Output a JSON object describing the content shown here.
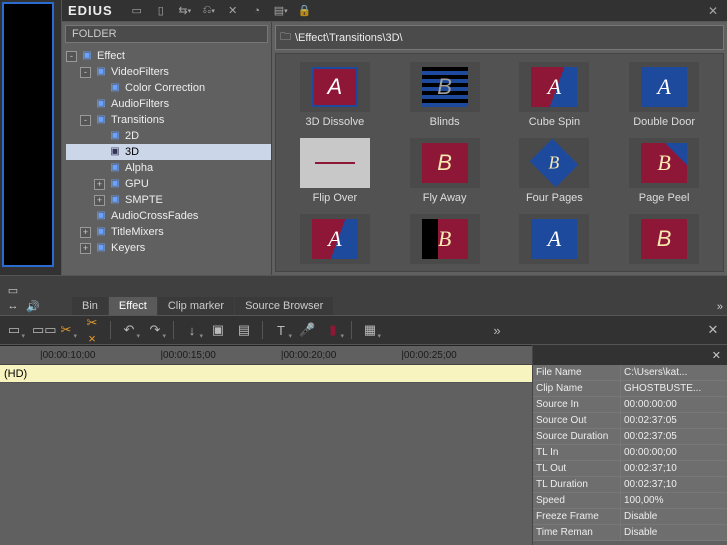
{
  "app": {
    "title": "EDIUS"
  },
  "folder": {
    "header": "FOLDER",
    "tree": [
      {
        "ind": 1,
        "exp": "-",
        "icon": "▣",
        "label": "Effect"
      },
      {
        "ind": 2,
        "exp": "-",
        "icon": "▣",
        "label": "VideoFilters"
      },
      {
        "ind": 3,
        "exp": " ",
        "icon": "▣",
        "label": "Color Correction"
      },
      {
        "ind": 2,
        "exp": " ",
        "icon": "▣",
        "label": "AudioFilters"
      },
      {
        "ind": 2,
        "exp": "-",
        "icon": "▣",
        "label": "Transitions"
      },
      {
        "ind": 3,
        "exp": " ",
        "icon": "▣",
        "label": "2D"
      },
      {
        "ind": 3,
        "exp": " ",
        "icon": "▣",
        "label": "3D",
        "sel": true
      },
      {
        "ind": 3,
        "exp": " ",
        "icon": "▣",
        "label": "Alpha"
      },
      {
        "ind": 3,
        "exp": "+",
        "icon": "▣",
        "label": "GPU"
      },
      {
        "ind": 3,
        "exp": "+",
        "icon": "▣",
        "label": "SMPTE"
      },
      {
        "ind": 2,
        "exp": " ",
        "icon": "▣",
        "label": "AudioCrossFades"
      },
      {
        "ind": 2,
        "exp": "+",
        "icon": "▣",
        "label": "TitleMixers"
      },
      {
        "ind": 2,
        "exp": "+",
        "icon": "▣",
        "label": "Keyers"
      }
    ]
  },
  "browser": {
    "path": "\\Effect\\Transitions\\3D\\",
    "items": [
      {
        "label": "3D Dissolve",
        "glyph": "A",
        "style": "fx-A"
      },
      {
        "label": "Blinds",
        "glyph": "B",
        "style": "fx-blinds"
      },
      {
        "label": "Cube Spin",
        "glyph": "A",
        "style": "fx-cube"
      },
      {
        "label": "Double Door",
        "glyph": "A",
        "style": "fx-dd"
      },
      {
        "label": "Flip Over",
        "glyph": "",
        "style": "fx-flip"
      },
      {
        "label": "Fly Away",
        "glyph": "B",
        "style": "fx-B"
      },
      {
        "label": "Four Pages",
        "glyph": "B",
        "style": "fx-four"
      },
      {
        "label": "Page Peel",
        "glyph": "B",
        "style": "fx-peel"
      },
      {
        "label": "",
        "glyph": "A",
        "style": "fx-cube"
      },
      {
        "label": "",
        "glyph": "B",
        "style": "fx-last"
      },
      {
        "label": "",
        "glyph": "A",
        "style": "fx-dd"
      },
      {
        "label": "",
        "glyph": "B",
        "style": "fx-B"
      }
    ]
  },
  "tabs": [
    "Bin",
    "Effect",
    "Clip marker",
    "Source Browser"
  ],
  "tabs_active": 1,
  "ruler": [
    "|00:00:10;00",
    "|00:00:15;00",
    "|00:00:20;00",
    "|00:00:25;00"
  ],
  "track_label": "(HD)",
  "props": [
    {
      "k": "File Name",
      "v": "C:\\Users\\kat..."
    },
    {
      "k": "Clip Name",
      "v": "GHOSTBUSTE..."
    },
    {
      "k": "Source In",
      "v": "00:00:00:00"
    },
    {
      "k": "Source Out",
      "v": "00:02:37:05"
    },
    {
      "k": "Source Duration",
      "v": "00:02:37:05"
    },
    {
      "k": "TL In",
      "v": "00:00:00;00"
    },
    {
      "k": "TL Out",
      "v": "00:02:37;10"
    },
    {
      "k": "TL Duration",
      "v": "00:02:37;10"
    },
    {
      "k": "Speed",
      "v": "100,00%"
    },
    {
      "k": "Freeze Frame",
      "v": "Disable"
    },
    {
      "k": "Time Reman",
      "v": "Disable"
    }
  ]
}
